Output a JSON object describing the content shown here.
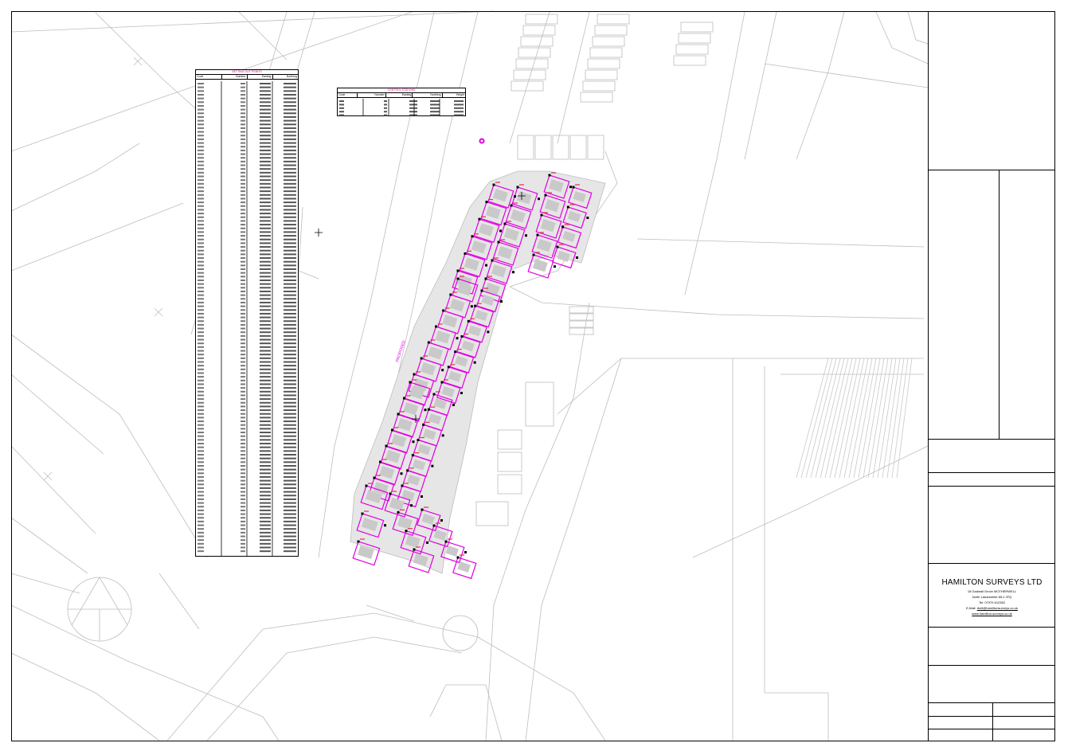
{
  "company": {
    "name": "HAMILTON SURVEYS LTD",
    "address": "18 Gadwall Grove MOTHERWELL",
    "region": "North Lanarkshire ML1 2FQ",
    "tel": "Tel:  07979 612362",
    "email_label": "E-Mail:",
    "email": "rbell@hamiltonsurveys.co.uk",
    "website": "www.hamilton-surveys.co.uk"
  },
  "setting_out_points": {
    "title": "SETTING OUT POINTS",
    "columns": [
      "Code",
      "Number",
      "Easting",
      "Northing"
    ]
  },
  "control_stations": {
    "title": "CONTROL STATIONS",
    "columns": [
      "Code",
      "Number",
      "Easting",
      "Northing",
      "Height"
    ]
  },
  "colors": {
    "linework": "#b8b8b8",
    "setting_out": "#e000e0",
    "building": "#bdbdbd",
    "frame": "#000000"
  }
}
